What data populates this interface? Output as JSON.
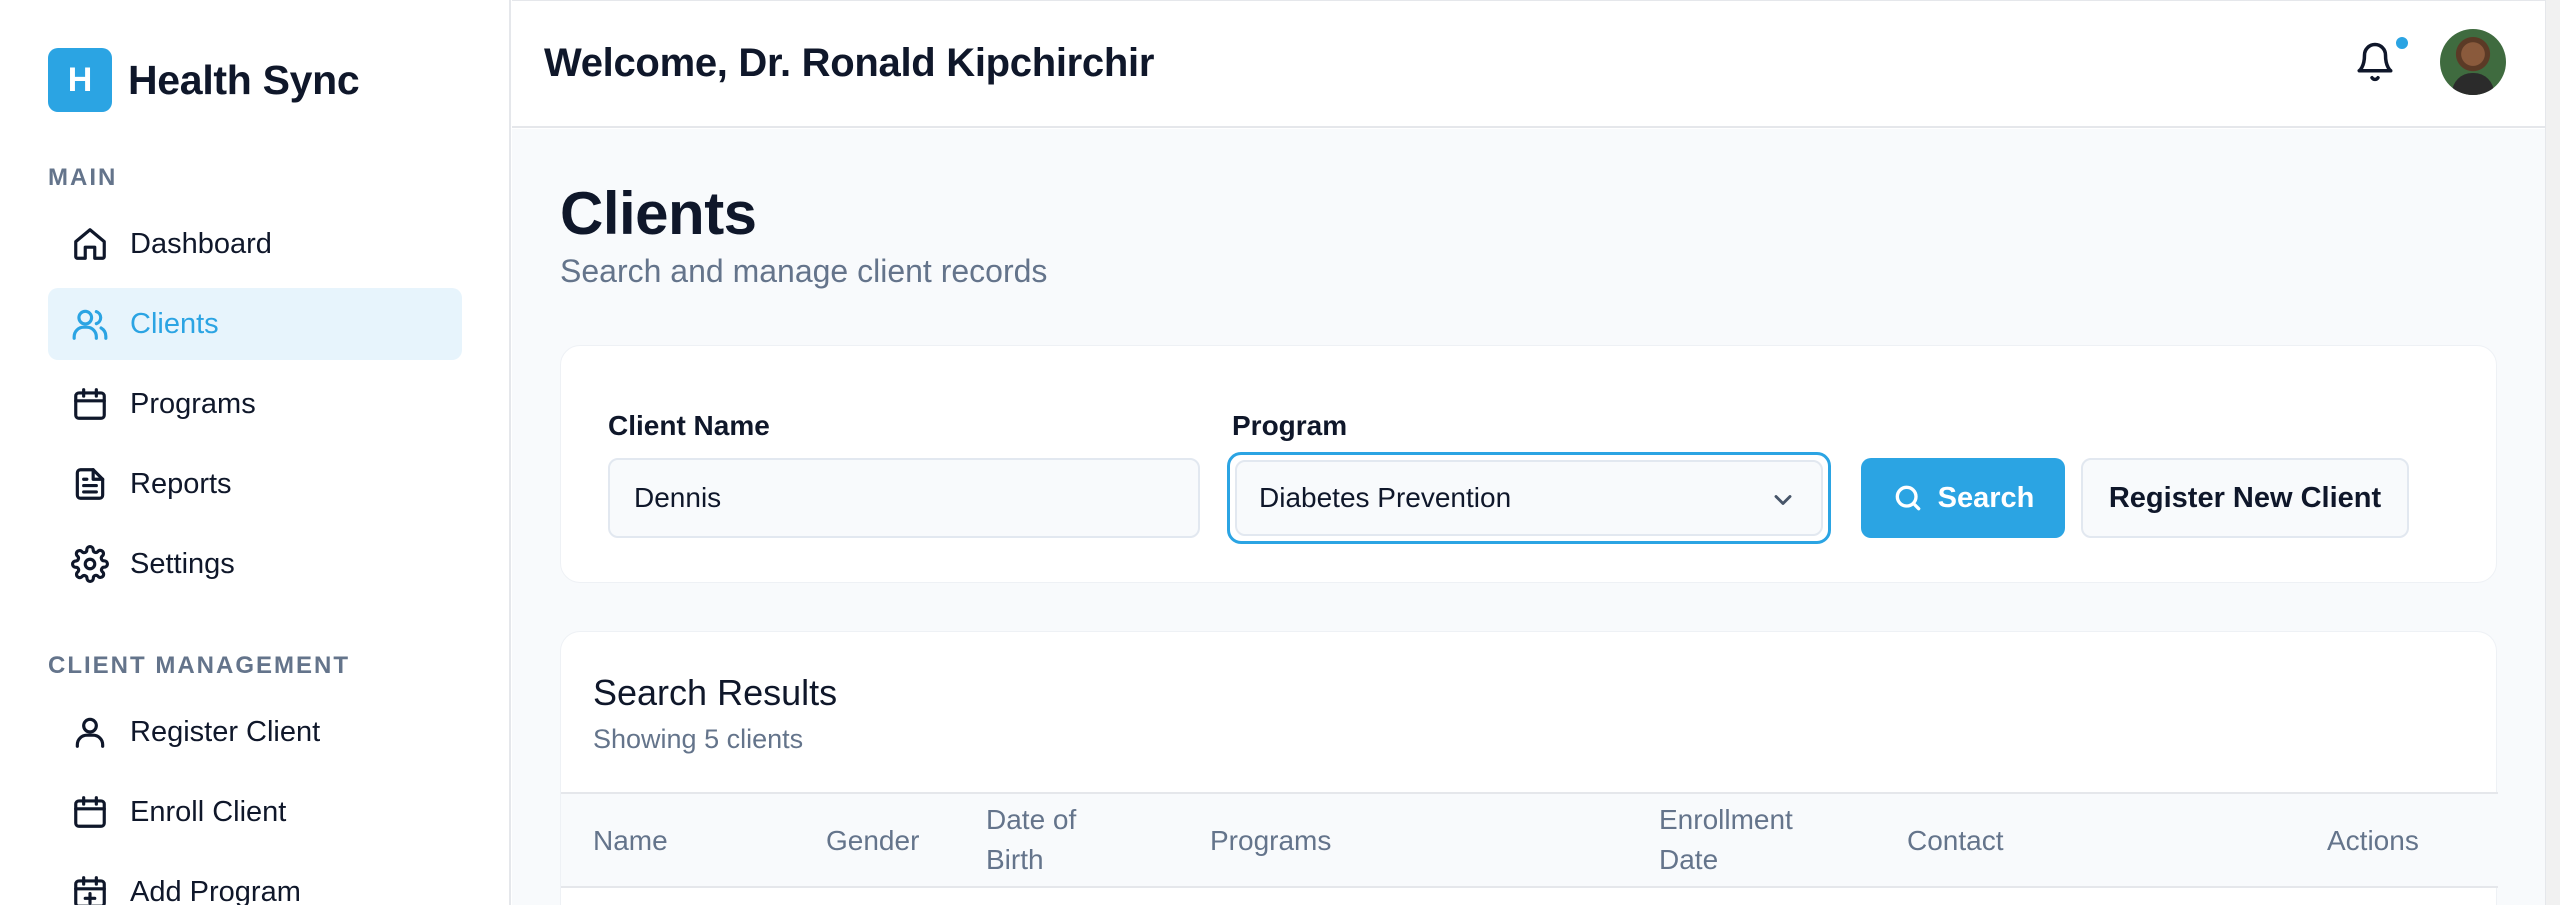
{
  "brand": {
    "logo_letter": "H",
    "name": "Health Sync"
  },
  "sidebar": {
    "sections": [
      {
        "label": "MAIN"
      },
      {
        "label": "CLIENT MANAGEMENT"
      }
    ],
    "main_items": [
      {
        "label": "Dashboard",
        "icon": "home-icon",
        "active": false
      },
      {
        "label": "Clients",
        "icon": "users-icon",
        "active": true
      },
      {
        "label": "Programs",
        "icon": "calendar-icon",
        "active": false
      },
      {
        "label": "Reports",
        "icon": "document-icon",
        "active": false
      },
      {
        "label": "Settings",
        "icon": "gear-icon",
        "active": false
      }
    ],
    "management_items": [
      {
        "label": "Register Client",
        "icon": "user-icon"
      },
      {
        "label": "Enroll Client",
        "icon": "calendar-icon"
      },
      {
        "label": "Add Program",
        "icon": "calendar-plus-icon"
      }
    ]
  },
  "header": {
    "welcome": "Welcome, Dr. Ronald Kipchirchir",
    "notification_icon": "bell-icon",
    "has_unread": true
  },
  "page": {
    "title": "Clients",
    "subtitle": "Search and manage client records"
  },
  "search": {
    "client_name_label": "Client Name",
    "client_name_value": "Dennis",
    "program_label": "Program",
    "program_value": "Diabetes Prevention",
    "search_button": "Search",
    "register_button": "Register New Client"
  },
  "results": {
    "title": "Search Results",
    "subtitle": "Showing 5 clients",
    "columns": [
      "Name",
      "Gender",
      "Date of Birth",
      "Programs",
      "Enrollment Date",
      "Contact",
      "Actions"
    ]
  },
  "colors": {
    "accent": "#2ba4e3",
    "active_bg": "#e7f4fc",
    "text": "#0f172a",
    "muted": "#64748b"
  }
}
